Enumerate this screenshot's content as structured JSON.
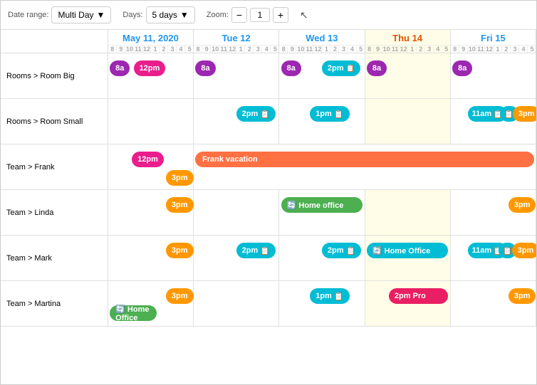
{
  "toolbar": {
    "date_range_label": "Date range:",
    "date_range_value": "Multi Day",
    "days_label": "Days:",
    "days_value": "5 days",
    "zoom_label": "Zoom:",
    "zoom_value": "1",
    "zoom_minus": "−",
    "zoom_plus": "+"
  },
  "dates": [
    {
      "label": "May 11, 2020",
      "short": "May 11, 2020",
      "dayClass": "mon",
      "isToday": false,
      "ticks": [
        "8",
        "9",
        "10",
        "11",
        "12",
        "1",
        "2",
        "3",
        "4",
        "5"
      ]
    },
    {
      "label": "Tue 12",
      "short": "Tue 12",
      "dayClass": "tue",
      "isToday": false,
      "ticks": [
        "8",
        "9",
        "10",
        "11",
        "12",
        "1",
        "2",
        "3",
        "4",
        "5"
      ]
    },
    {
      "label": "Wed 13",
      "short": "Wed 13",
      "dayClass": "wed",
      "isToday": false,
      "ticks": [
        "8",
        "9",
        "10",
        "11",
        "12",
        "1",
        "2",
        "3",
        "4",
        "5"
      ]
    },
    {
      "label": "Thu 14",
      "short": "Thu 14",
      "dayClass": "thu",
      "isToday": true,
      "ticks": [
        "8",
        "9",
        "10",
        "11",
        "12",
        "1",
        "2",
        "3",
        "4",
        "5"
      ]
    },
    {
      "label": "Fri 15",
      "short": "Fri 15",
      "dayClass": "fri",
      "isToday": false,
      "ticks": [
        "8",
        "9",
        "10",
        "11",
        "12",
        "1",
        "2",
        "3",
        "4",
        "5"
      ]
    }
  ],
  "resources": [
    {
      "label": "Rooms > Room Big",
      "events": [
        {
          "day": 0,
          "label": "8a",
          "color": "purple",
          "left": "2%",
          "width": "6%"
        },
        {
          "day": 0,
          "label": "12pm",
          "color": "pink",
          "left": "27%",
          "width": "12%"
        },
        {
          "day": 1,
          "label": "8a",
          "color": "purple",
          "left": "2%",
          "width": "6%"
        },
        {
          "day": 2,
          "label": "8a",
          "color": "purple",
          "left": "2%",
          "width": "6%"
        },
        {
          "day": 2,
          "label": "2pm",
          "color": "teal",
          "left": "55%",
          "width": "14%",
          "icon": "📋"
        },
        {
          "day": 3,
          "label": "8a",
          "color": "purple",
          "left": "2%",
          "width": "6%"
        },
        {
          "day": 4,
          "label": "8a",
          "color": "purple",
          "left": "2%",
          "width": "6%"
        }
      ]
    },
    {
      "label": "Rooms > Room Small",
      "events": [
        {
          "day": 1,
          "label": "2pm",
          "color": "teal",
          "left": "55%",
          "width": "14%",
          "icon": "📋"
        },
        {
          "day": 2,
          "label": "1pm",
          "color": "teal",
          "left": "41%",
          "width": "14%",
          "icon": "📋"
        },
        {
          "day": 4,
          "label": "11am",
          "color": "teal",
          "left": "24%",
          "width": "10%",
          "icon": "📋"
        },
        {
          "day": 4,
          "label": "",
          "color": "teal",
          "left": "35%",
          "width": "6%",
          "icon": "📋"
        },
        {
          "day": 4,
          "label": "3pm",
          "color": "orange",
          "left": "70%",
          "width": "10%"
        }
      ]
    },
    {
      "label": "Team > Frank",
      "events": [
        {
          "day": 0,
          "label": "12pm",
          "color": "pink",
          "left": "27%",
          "width": "12%"
        },
        {
          "day": 0,
          "label": "3pm",
          "color": "orange",
          "left": "71%",
          "width": "10%"
        }
      ],
      "spanEvent": {
        "label": "Frank vacation",
        "color": "orange-vacation",
        "startDay": 1,
        "left": "3%",
        "width": "96%"
      }
    },
    {
      "label": "Team > Linda",
      "events": [
        {
          "day": 0,
          "label": "3pm",
          "color": "orange",
          "left": "71%",
          "width": "10%"
        },
        {
          "day": 2,
          "label": "🔄 Home office",
          "color": "green",
          "left": "2%",
          "width": "60%"
        },
        {
          "day": 4,
          "label": "3pm",
          "color": "orange",
          "left": "71%",
          "width": "10%"
        }
      ]
    },
    {
      "label": "Team > Mark",
      "events": [
        {
          "day": 0,
          "label": "3pm",
          "color": "orange",
          "left": "71%",
          "width": "10%"
        },
        {
          "day": 1,
          "label": "2pm",
          "color": "teal",
          "left": "55%",
          "width": "14%",
          "icon": "📋"
        },
        {
          "day": 2,
          "label": "2pm",
          "color": "teal",
          "left": "55%",
          "width": "14%",
          "icon": "📋"
        },
        {
          "day": 3,
          "label": "🔄 Home Office",
          "color": "teal",
          "left": "2%",
          "width": "60%"
        },
        {
          "day": 4,
          "label": "11am",
          "color": "teal",
          "left": "24%",
          "width": "10%",
          "icon": "📋"
        },
        {
          "day": 4,
          "label": "",
          "color": "teal",
          "left": "35%",
          "width": "6%",
          "icon": "📋"
        },
        {
          "day": 4,
          "label": "3pm",
          "color": "orange",
          "left": "70%",
          "width": "10%"
        }
      ]
    },
    {
      "label": "Team > Martina",
      "events": [
        {
          "day": 0,
          "label": "3pm",
          "color": "orange",
          "left": "71%",
          "width": "10%"
        },
        {
          "day": 0,
          "label": "🔄 Home Office",
          "color": "green",
          "left": "2%",
          "width": "52%"
        },
        {
          "day": 2,
          "label": "1pm",
          "color": "teal",
          "left": "41%",
          "width": "14%",
          "icon": "📋"
        },
        {
          "day": 3,
          "label": "2pm Pro",
          "color": "magenta",
          "left": "32%",
          "width": "35%"
        },
        {
          "day": 4,
          "label": "3pm",
          "color": "orange",
          "left": "71%",
          "width": "10%"
        }
      ]
    }
  ]
}
